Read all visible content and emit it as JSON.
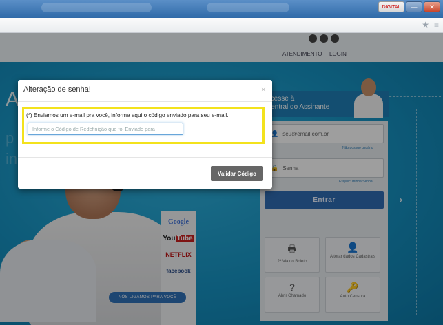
{
  "window": {
    "lang_indicator": "DIGITAL",
    "minimize_glyph": "—",
    "close_glyph": "✕"
  },
  "toolbar": {
    "bookmark_icon": "star-icon",
    "star_glyph": "★",
    "menu_glyph": "≡"
  },
  "header": {
    "nav": [
      "ATENDIMENTO",
      "LOGIN"
    ],
    "social_icons": [
      "social-icon-1",
      "twitter-icon",
      "facebook-icon"
    ]
  },
  "hero": {
    "letter": "A",
    "faded_letter_1": "p",
    "faded_letter_2": "in",
    "brands": {
      "google": "Google",
      "youtube_you": "You",
      "youtube_tube": "Tube",
      "netflix": "NETFLIX",
      "facebook": "facebook"
    },
    "callout": "NÓS LIGAMOS PARA VOCÊ"
  },
  "login": {
    "title_line1": "Acesse à",
    "title_line2": "Central do Assinante",
    "email_placeholder": "seu@email.com.br",
    "no_password_link": "Não possuo usuário",
    "password_placeholder": "Senha",
    "forgot_link": "Esqueci minha Senha",
    "submit_label": "Entrar",
    "tiles": [
      {
        "icon": "printer-icon",
        "glyph": "🖶",
        "label": "2ª Via do Boleto"
      },
      {
        "icon": "user-icon",
        "glyph": "👤",
        "label": "Alterar dados Cadastrais"
      },
      {
        "icon": "question-icon",
        "glyph": "?",
        "label": "Abrir Chamado"
      },
      {
        "icon": "key-icon",
        "glyph": "🔑",
        "label": "Auto Censura"
      }
    ]
  },
  "modal": {
    "title": "Alteração de senha!",
    "close_glyph": "×",
    "message": "(*) Enviamos um e-mail pra você, informe aqui o código enviado para seu e-mail.",
    "code_placeholder": "Informe o Código de Redefinição que foi Enviado para",
    "code_value": "",
    "submit_label": "Validar Código"
  },
  "colors": {
    "highlight": "#f3e21c",
    "brand_blue": "#1c98c6",
    "button_gray": "#666666"
  }
}
